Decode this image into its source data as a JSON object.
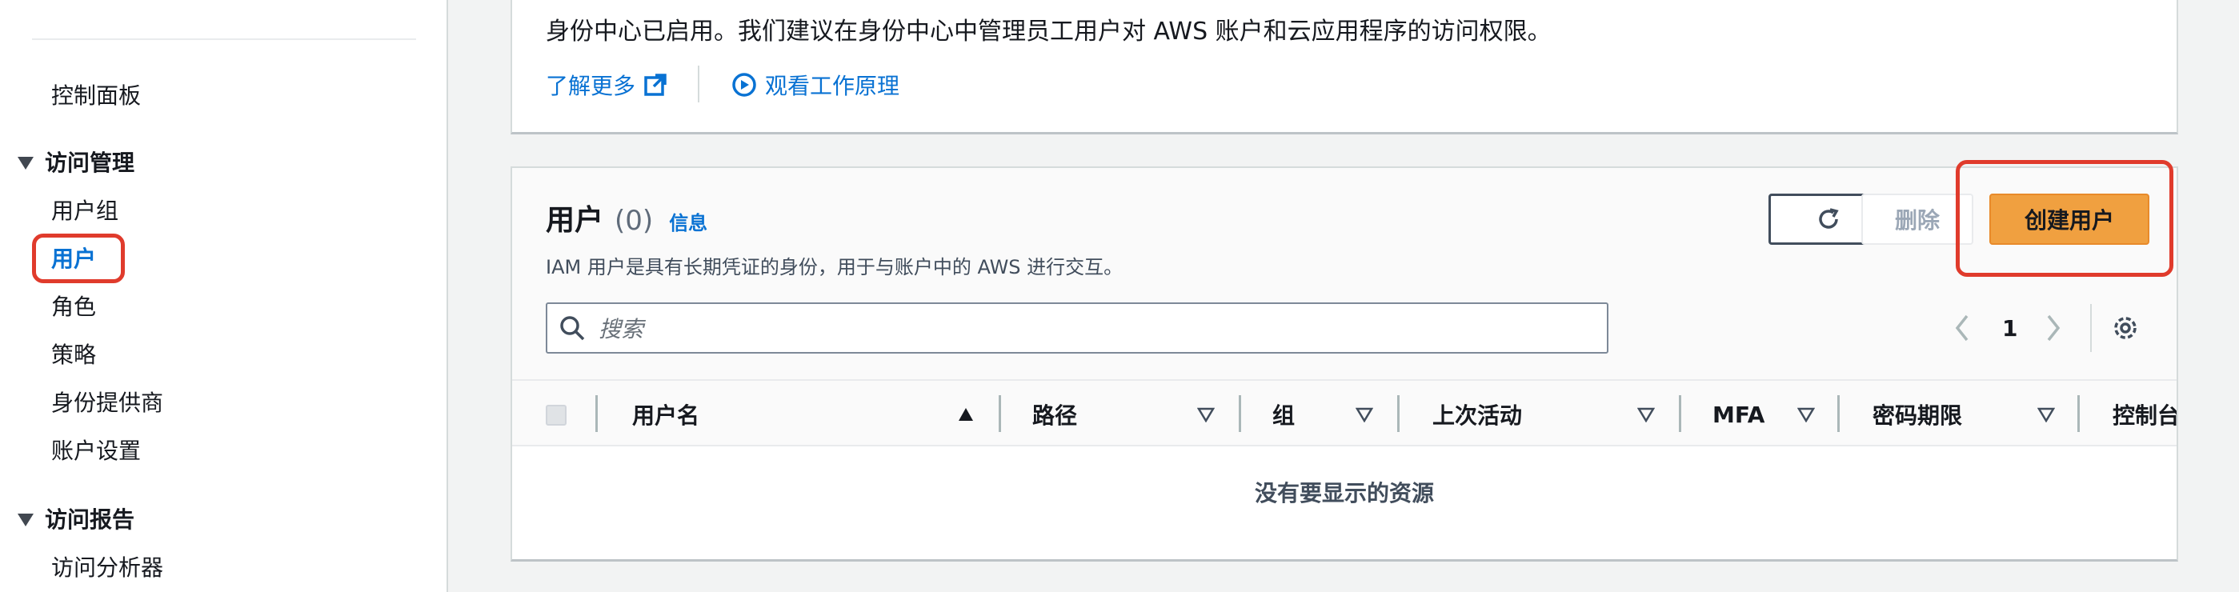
{
  "sidebar": {
    "items": [
      {
        "label": "控制面板"
      },
      {
        "section": "访问管理"
      },
      {
        "label": "用户组"
      },
      {
        "label": "用户",
        "active": true
      },
      {
        "label": "角色"
      },
      {
        "label": "策略"
      },
      {
        "label": "身份提供商"
      },
      {
        "label": "账户设置"
      },
      {
        "section": "访问报告"
      },
      {
        "label": "访问分析器"
      }
    ]
  },
  "info_banner": {
    "text": "身份中心已启用。我们建议在身份中心中管理员工用户对 AWS 账户和云应用程序的访问权限。",
    "learn_more": "了解更多",
    "watch": "观看工作原理"
  },
  "users": {
    "title": "用户",
    "count": "(0)",
    "info": "信息",
    "description": "IAM 用户是具有长期凭证的身份，用于与账户中的 AWS 进行交互。",
    "delete_label": "删除",
    "create_label": "创建用户",
    "search_placeholder": "搜索",
    "page": "1",
    "columns": [
      "用户名",
      "路径",
      "组",
      "上次活动",
      "MFA",
      "密码期限",
      "控制台"
    ],
    "empty_text": "没有要显示的资源"
  },
  "colors": {
    "link": "#0972d3",
    "primary_button": "#f0a040",
    "highlight": "#e03b2c"
  }
}
